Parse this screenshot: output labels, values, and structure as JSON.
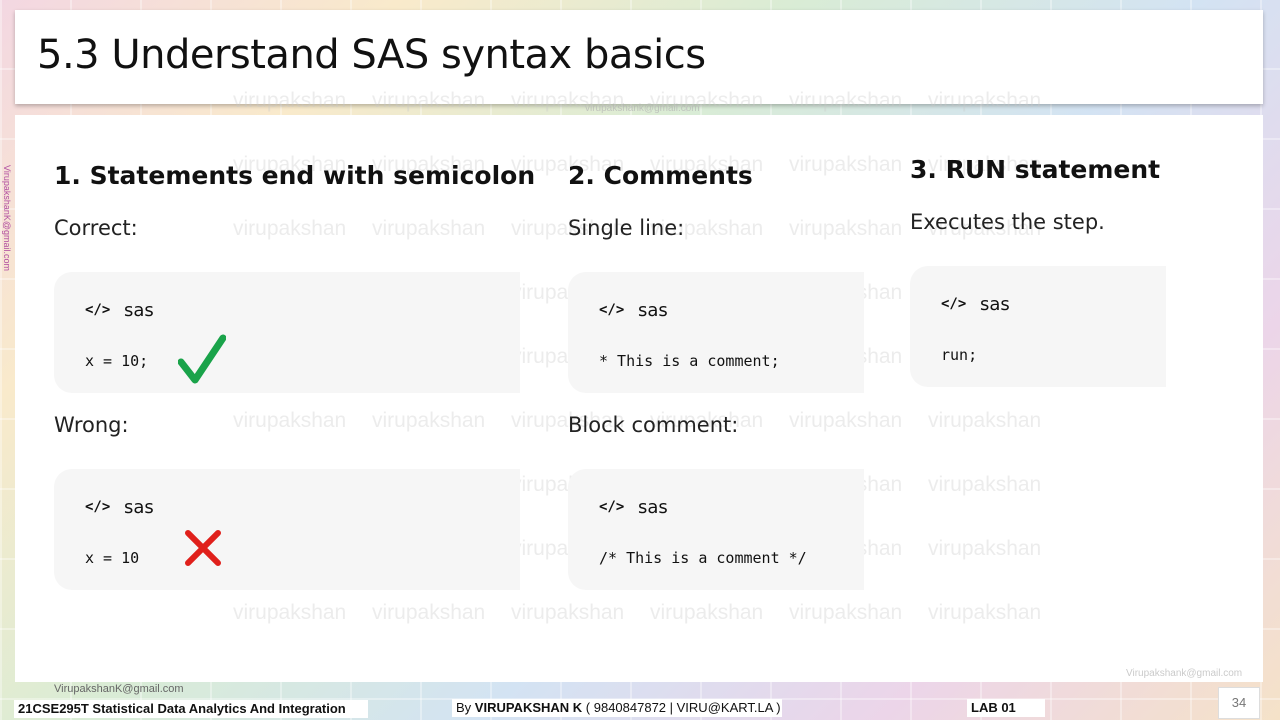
{
  "slide": {
    "title": "5.3 Understand SAS syntax basics",
    "page_number": "34"
  },
  "columns": [
    {
      "heading": "1. Statements end with semicolon",
      "blocks": [
        {
          "label": "Correct:",
          "lang_icon": "</>",
          "lang": "sas",
          "code": "x = 10;",
          "mark": "check-icon"
        },
        {
          "label": "Wrong:",
          "lang_icon": "</>",
          "lang": "sas",
          "code": "x = 10",
          "mark": "cross-icon"
        }
      ]
    },
    {
      "heading": "2. Comments",
      "blocks": [
        {
          "label": "Single line:",
          "lang_icon": "</>",
          "lang": "sas",
          "code": "* This is a comment;"
        },
        {
          "label": "Block comment:",
          "lang_icon": "</>",
          "lang": "sas",
          "code": "/* This is a comment */"
        }
      ]
    },
    {
      "heading": "3. RUN statement",
      "blocks": [
        {
          "label": "Executes the step.",
          "lang_icon": "</>",
          "lang": "sas",
          "code": "run;"
        }
      ]
    }
  ],
  "watermark": {
    "word": "virupakshan",
    "email": "VirupakshanK@gmail.com",
    "email_top": "virupakshank@gmail.com",
    "email_right": "Virupakshank@gmail.com"
  },
  "footer": {
    "course": "21CSE295T Statistical Data Analytics And Integration",
    "by_prefix": "By ",
    "author": "VIRUPAKSHAN K",
    "contact": " ( 9840847872 | VIRU@KART.LA )",
    "lab": "LAB  01"
  },
  "colors": {
    "check": "#1aa34a",
    "cross": "#e0201b"
  }
}
